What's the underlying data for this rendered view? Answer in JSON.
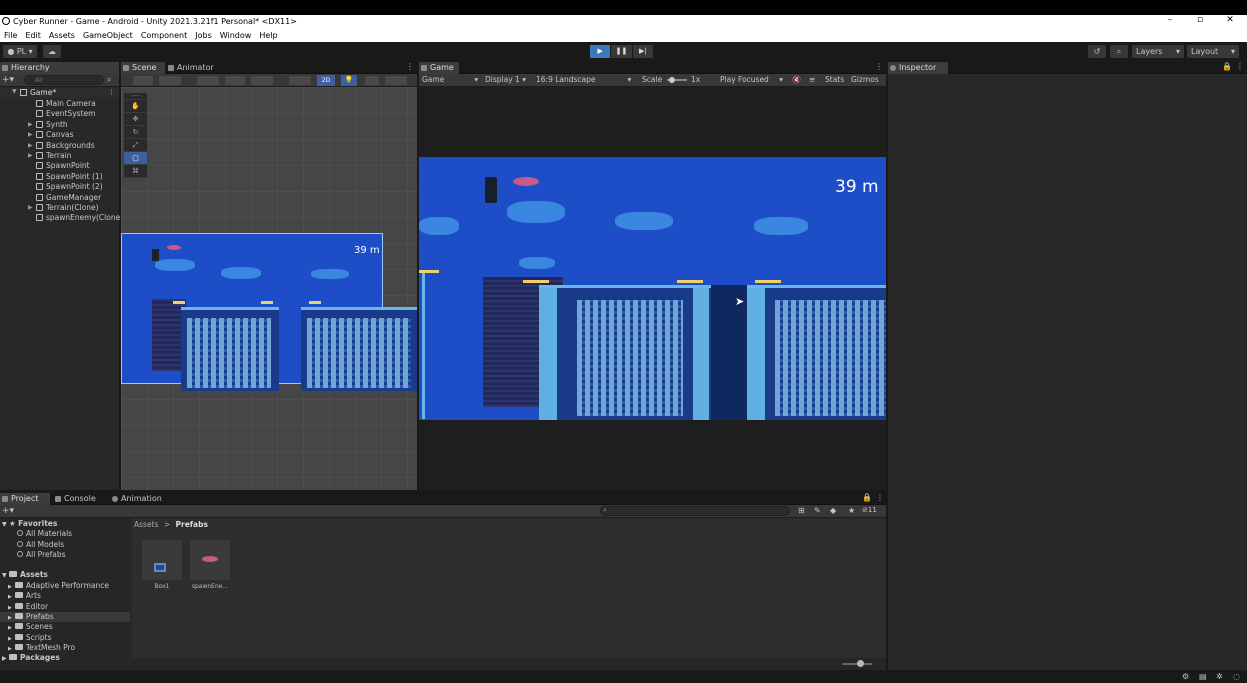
{
  "window": {
    "title": "Cyber Runner - Game - Android - Unity 2021.3.21f1 Personal* <DX11>"
  },
  "menu": [
    "File",
    "Edit",
    "Assets",
    "GameObject",
    "Component",
    "Jobs",
    "Window",
    "Help"
  ],
  "toolbar": {
    "account": "PL",
    "layers": "Layers",
    "layout": "Layout"
  },
  "hierarchy": {
    "tab": "Hierarchy",
    "search_placeholder": "All",
    "scene": "Game*",
    "items": [
      {
        "label": "Main Camera",
        "expandable": false
      },
      {
        "label": "EventSystem",
        "expandable": false
      },
      {
        "label": "Synth",
        "expandable": true
      },
      {
        "label": "Canvas",
        "expandable": true
      },
      {
        "label": "Backgrounds",
        "expandable": true
      },
      {
        "label": "Terrain",
        "expandable": true
      },
      {
        "label": "SpawnPoint",
        "expandable": false
      },
      {
        "label": "SpawnPoint (1)",
        "expandable": false
      },
      {
        "label": "SpawnPoint (2)",
        "expandable": false
      },
      {
        "label": "GameManager",
        "expandable": false
      },
      {
        "label": "Terrain(Clone)",
        "expandable": true
      },
      {
        "label": "spawnEnemy(Clone",
        "expandable": false
      }
    ]
  },
  "scene_view": {
    "tabs": [
      "Scene",
      "Animator"
    ],
    "mode_2d": "2D",
    "distance": "39 m"
  },
  "game_view": {
    "tab": "Game",
    "view_select": "Game",
    "display": "Display 1",
    "aspect": "16:9 Landscape",
    "scale_label": "Scale",
    "scale_value": "1x",
    "play_mode": "Play Focused",
    "stats": "Stats",
    "gizmos": "Gizmos",
    "distance": "39 m"
  },
  "inspector": {
    "tab": "Inspector"
  },
  "bottom": {
    "tabs": [
      "Project",
      "Console",
      "Animation"
    ],
    "favorites_label": "Favorites",
    "favorites": [
      "All Materials",
      "All Models",
      "All Prefabs"
    ],
    "assets_label": "Assets",
    "assets": [
      "Adaptive Performance",
      "Arts",
      "Editor",
      "Prefabs",
      "Scenes",
      "Scripts",
      "TextMesh Pro"
    ],
    "selected_asset": "Prefabs",
    "packages_label": "Packages",
    "breadcrumb": [
      "Assets",
      "Prefabs"
    ],
    "breadcrumb_sep": ">",
    "hidden_count": "11",
    "prefabs": [
      {
        "name": "Box1"
      },
      {
        "name": "spawnEne..."
      }
    ]
  },
  "colors": {
    "accent": "#3a79bb",
    "sky": "#1d4ec8",
    "panel": "#282828"
  }
}
